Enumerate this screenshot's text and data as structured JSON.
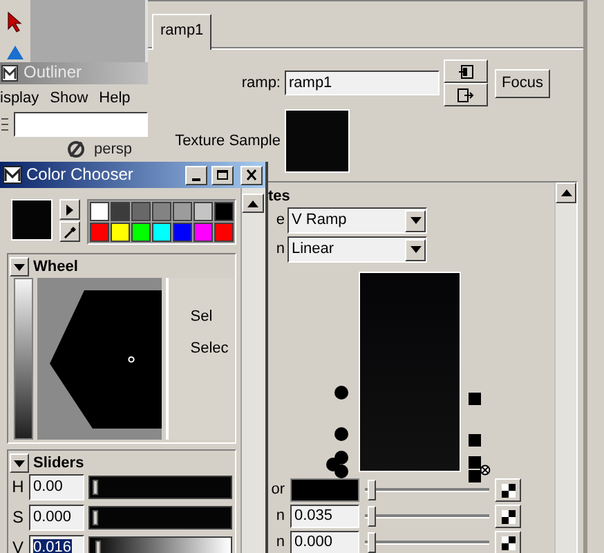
{
  "outliner": {
    "title": "Outliner",
    "menu": [
      "isplay",
      "Show",
      "Help"
    ],
    "items": [
      {
        "label": "persp"
      }
    ]
  },
  "attribute_editor": {
    "tabs": [
      {
        "label": "ramp1",
        "selected": true
      }
    ],
    "ramp_label": "ramp:",
    "ramp_name": "ramp1",
    "focus_button": "Focus",
    "texture_sample_label": "Texture Sample",
    "section_title": "tes",
    "dropdowns": [
      {
        "label": "e",
        "value": "V Ramp"
      },
      {
        "label": "n",
        "value": "Linear"
      }
    ],
    "entries": [
      {
        "label": "or",
        "kind": "color",
        "level": 0.02
      },
      {
        "label": "n",
        "kind": "number",
        "value": "0.035",
        "level": 0.02
      },
      {
        "label": "n",
        "kind": "number",
        "value": "0.000",
        "level": 0.02
      }
    ]
  },
  "color_chooser": {
    "title": "Color Chooser",
    "palette": [
      {
        "color": "#ffffff"
      },
      {
        "color": "#3c3c3c"
      },
      {
        "color": "#686868"
      },
      {
        "color": "#838383"
      },
      {
        "color": "#9c9c9c"
      },
      {
        "color": "#c4c4c4"
      },
      {
        "color": "#000000"
      },
      {
        "color": "#ff0000"
      },
      {
        "color": "#ffff00"
      },
      {
        "color": "#00ff00"
      },
      {
        "color": "#00ffff"
      },
      {
        "color": "#0000ff"
      },
      {
        "color": "#ff00ff"
      },
      {
        "color": "#ff0000"
      }
    ],
    "wheel_section": "Wheel",
    "wheel_labels": [
      "Sel",
      "Selec"
    ],
    "sliders_section": "Sliders",
    "sliders": [
      {
        "label": "H",
        "value": "0.00",
        "kind": "solid",
        "selected": false,
        "level": 0.0
      },
      {
        "label": "S",
        "value": "0.000",
        "kind": "solid",
        "selected": false,
        "level": 0.0
      },
      {
        "label": "V",
        "value": "0.016",
        "kind": "gradient",
        "selected": true,
        "level": 0.016
      }
    ]
  }
}
